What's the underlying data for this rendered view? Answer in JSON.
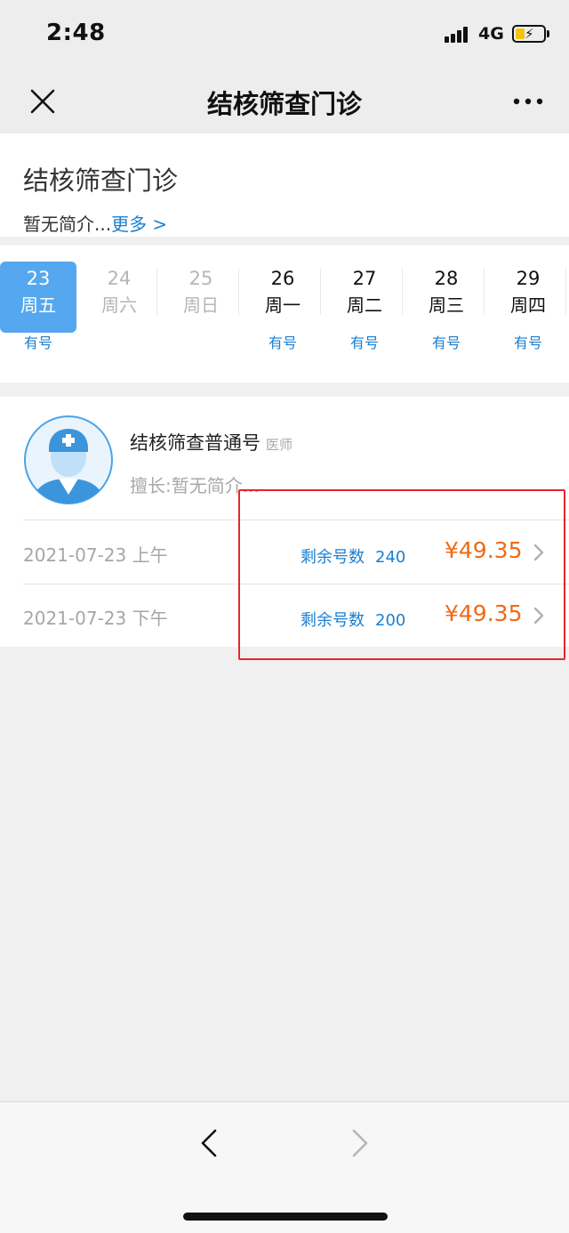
{
  "status_bar": {
    "time": "2:48",
    "network": "4G"
  },
  "nav": {
    "title": "结核筛查门诊"
  },
  "header": {
    "title": "结核筛查门诊",
    "desc": "暂无简介...",
    "more": "更多 >"
  },
  "dates": [
    {
      "day": "23",
      "week": "周五",
      "status": "有号"
    },
    {
      "day": "24",
      "week": "周六",
      "status": ""
    },
    {
      "day": "25",
      "week": "周日",
      "status": ""
    },
    {
      "day": "26",
      "week": "周一",
      "status": "有号"
    },
    {
      "day": "27",
      "week": "周二",
      "status": "有号"
    },
    {
      "day": "28",
      "week": "周三",
      "status": "有号"
    },
    {
      "day": "29",
      "week": "周四",
      "status": "有号"
    }
  ],
  "doctor": {
    "name": "结核筛查普通号",
    "title": "医师",
    "specialty": "擅长:暂无简介..."
  },
  "slots": [
    {
      "date": "2021-07-23 上午",
      "remain_label": "剩余号数",
      "remain": "240",
      "price": "¥49.35"
    },
    {
      "date": "2021-07-23 下午",
      "remain_label": "剩余号数",
      "remain": "200",
      "price": "¥49.35"
    }
  ],
  "icons": {
    "close": "close-icon",
    "more": "more-dots-icon",
    "back": "chevron-left-icon",
    "forward": "chevron-right-icon",
    "avatar": "doctor-avatar-icon"
  },
  "colors": {
    "accent": "#1a7fd1",
    "selected": "#55a8ef",
    "price": "#f06a14",
    "highlight": "#e5262b"
  }
}
